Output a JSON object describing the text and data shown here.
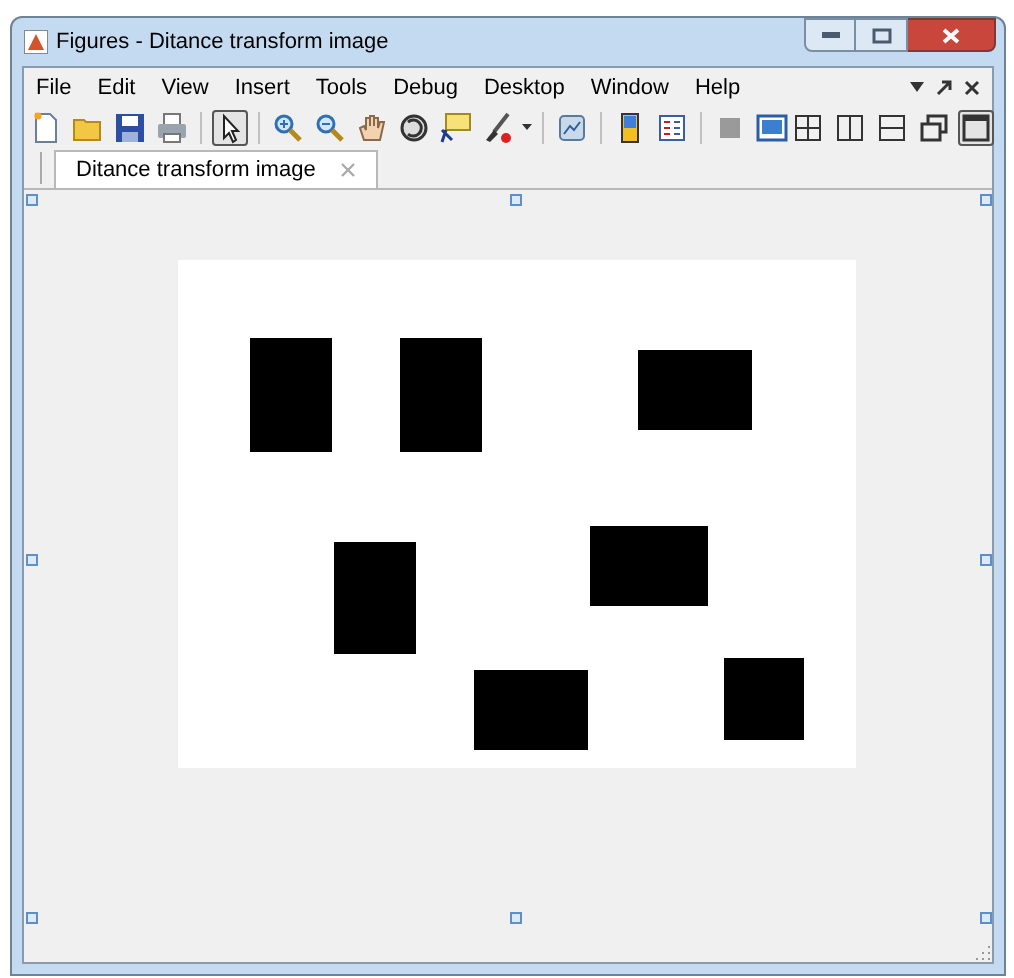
{
  "window": {
    "title": "Figures - Ditance transform image"
  },
  "menu": [
    "File",
    "Edit",
    "View",
    "Insert",
    "Tools",
    "Debug",
    "Desktop",
    "Window",
    "Help"
  ],
  "toolbar": {
    "tools": [
      {
        "kind": "new",
        "selected": false
      },
      {
        "kind": "open",
        "selected": false
      },
      {
        "kind": "save",
        "selected": false
      },
      {
        "kind": "print",
        "selected": false
      },
      {
        "kind": "sep"
      },
      {
        "kind": "pointer",
        "selected": true
      },
      {
        "kind": "sep"
      },
      {
        "kind": "zoomin",
        "selected": false
      },
      {
        "kind": "zoomout",
        "selected": false
      },
      {
        "kind": "pan",
        "selected": false
      },
      {
        "kind": "rotate",
        "selected": false
      },
      {
        "kind": "cursor",
        "selected": false
      },
      {
        "kind": "brush",
        "selected": false
      },
      {
        "kind": "caret"
      },
      {
        "kind": "sep"
      },
      {
        "kind": "link",
        "selected": false
      },
      {
        "kind": "sep"
      },
      {
        "kind": "colorbar",
        "selected": false
      },
      {
        "kind": "legend",
        "selected": false
      },
      {
        "kind": "sep"
      },
      {
        "kind": "hide",
        "selected": false
      },
      {
        "kind": "show",
        "selected": false
      }
    ],
    "layouts": [
      {
        "kind": "grid4",
        "selected": false
      },
      {
        "kind": "cols",
        "selected": false
      },
      {
        "kind": "rows",
        "selected": false
      },
      {
        "kind": "float",
        "selected": false
      },
      {
        "kind": "maximize",
        "selected": true
      }
    ]
  },
  "tabs": [
    {
      "label": "Ditance transform image",
      "selected": true
    }
  ]
}
